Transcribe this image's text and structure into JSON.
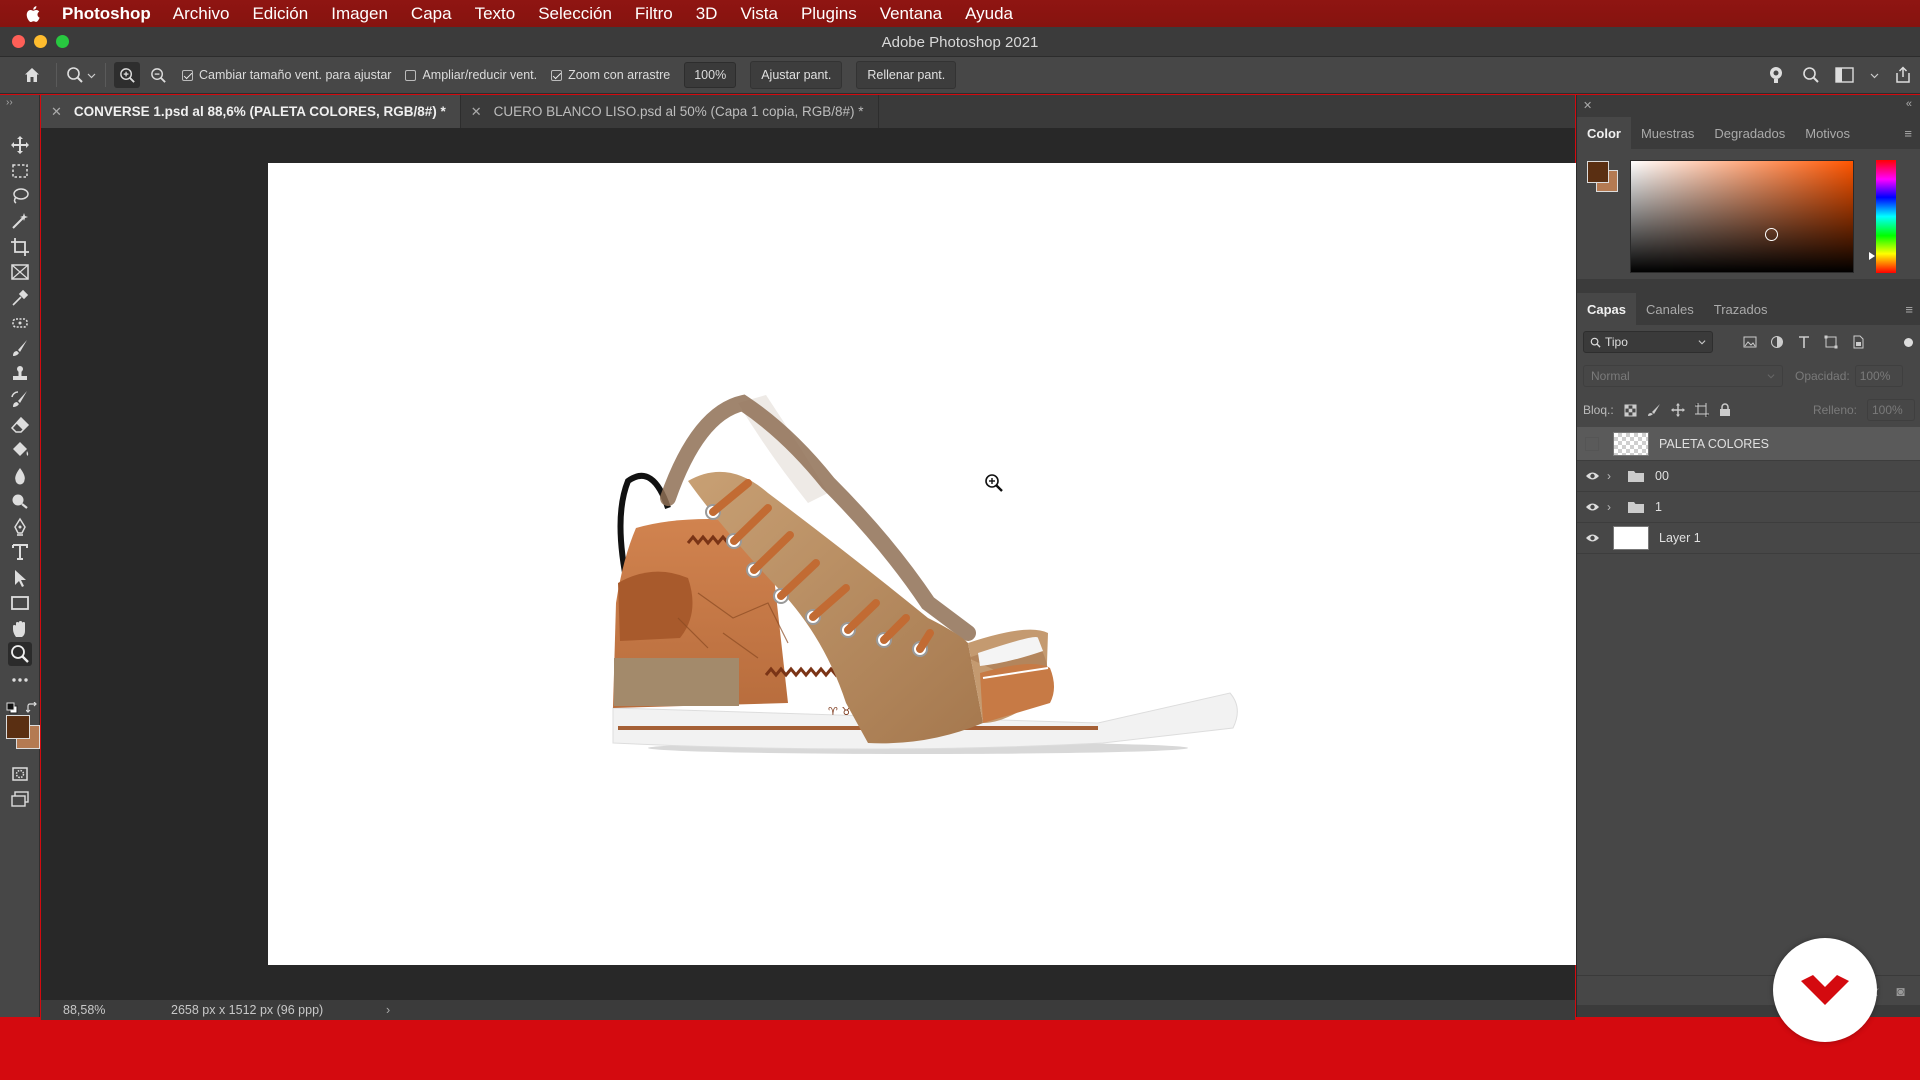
{
  "menubar": {
    "app_name": "Photoshop",
    "items": [
      "Archivo",
      "Edición",
      "Imagen",
      "Capa",
      "Texto",
      "Selección",
      "Filtro",
      "3D",
      "Vista",
      "Plugins",
      "Ventana",
      "Ayuda"
    ]
  },
  "window": {
    "title": "Adobe Photoshop 2021"
  },
  "options": {
    "resize_windows_label": "Cambiar tamaño vent. para ajustar",
    "resize_windows_checked": true,
    "zoom_all_label": "Ampliar/reducir vent.",
    "zoom_all_checked": false,
    "scrubby_zoom_label": "Zoom con arrastre",
    "scrubby_zoom_checked": true,
    "zoom_value": "100%",
    "fit_screen_label": "Ajustar pant.",
    "fill_screen_label": "Rellenar pant."
  },
  "tabs": [
    {
      "label": "CONVERSE 1.psd al 88,6% (PALETA COLORES, RGB/8#) *",
      "active": true
    },
    {
      "label": "CUERO BLANCO LISO.psd al 50% (Capa 1 copia, RGB/8#) *",
      "active": false
    }
  ],
  "status": {
    "zoom": "88,58%",
    "dimensions": "2658 px x 1512 px (96 ppp)"
  },
  "color_panel": {
    "tabs": [
      "Color",
      "Muestras",
      "Degradados",
      "Motivos"
    ],
    "foreground": "#5a2f12",
    "background": "#b47a52"
  },
  "layers_panel": {
    "tabs": [
      "Capas",
      "Canales",
      "Trazados"
    ],
    "filter_label": "Tipo",
    "blend_mode": "Normal",
    "opacity_label": "Opacidad:",
    "opacity_value": "100%",
    "lock_label": "Bloq.:",
    "fill_label": "Relleno:",
    "fill_value": "100%",
    "layers": [
      {
        "name": "PALETA COLORES",
        "kind": "layer",
        "visible": false,
        "selected": true,
        "thumb": "transparent"
      },
      {
        "name": "00",
        "kind": "group",
        "visible": true,
        "selected": false
      },
      {
        "name": "1",
        "kind": "group",
        "visible": true,
        "selected": false
      },
      {
        "name": "Layer 1",
        "kind": "layer",
        "visible": true,
        "selected": false,
        "thumb": "white"
      }
    ]
  },
  "colors": {
    "menubar": "#8f1512",
    "brand_red": "#d40a0f"
  }
}
